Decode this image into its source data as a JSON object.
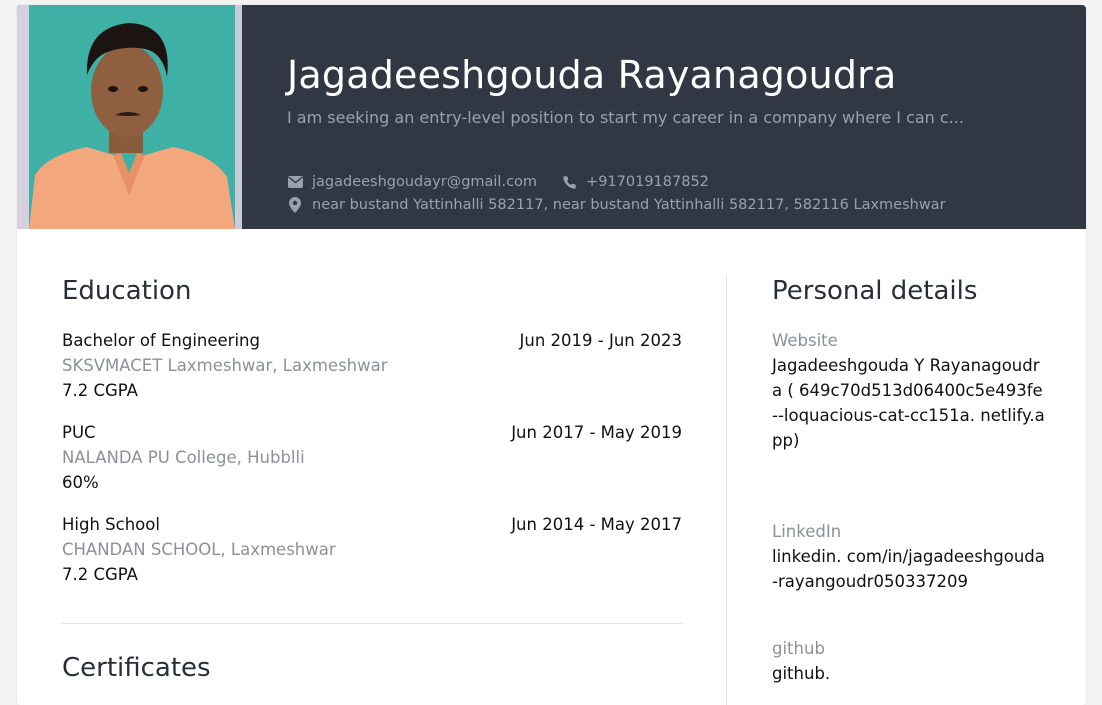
{
  "header": {
    "name": "Jagadeeshgouda Rayanagoudra",
    "summary": "I am seeking an entry-level position to start my career in a company where I can c...",
    "email": "jagadeeshgoudayr@gmail.com",
    "phone": "+917019187852",
    "address": "near bustand Yattinhalli 582117, near bustand Yattinhalli 582117, 582116 Laxmeshwar",
    "icons": [
      "envelope-icon",
      "phone-icon",
      "map-pin-icon"
    ],
    "colors": {
      "header_bg": "#323744",
      "photo_bg": "#3fb0a6"
    }
  },
  "education": {
    "title": "Education",
    "items": [
      {
        "degree": "Bachelor of Engineering",
        "dates": "Jun 2019 - Jun 2023",
        "school": "SKSVMACET  Laxmeshwar, Laxmeshwar",
        "grade": "7.2 CGPA"
      },
      {
        "degree": "PUC",
        "dates": "Jun 2017 - May 2019",
        "school": "NALANDA PU College, Hubblli",
        "grade": "60%"
      },
      {
        "degree": "High School",
        "dates": "Jun 2014 - May 2017",
        "school": "CHANDAN SCHOOL, Laxmeshwar",
        "grade": "7.2 CGPA"
      }
    ]
  },
  "certificates": {
    "title": "Certificates"
  },
  "personal": {
    "title": "Personal details",
    "website": {
      "label": "Website",
      "value": "Jagadeeshgouda Y Rayanagoudra ( 649c70d513d06400c5e493fe--loquacious-cat-cc151a. netlify.app)"
    },
    "linkedin": {
      "label": "LinkedIn",
      "value": "linkedin. com/in/jagadeeshgouda-rayangoudr050337209"
    },
    "github": {
      "label": "github",
      "value": "github."
    }
  }
}
